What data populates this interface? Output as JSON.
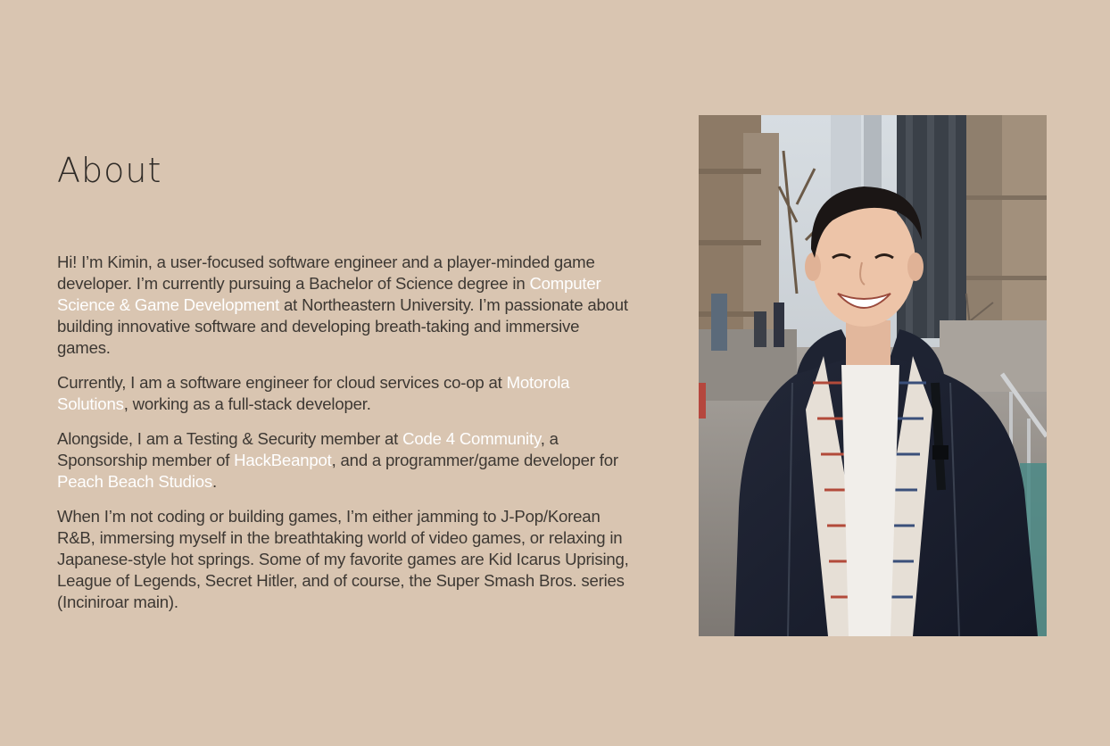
{
  "about": {
    "title": "About",
    "p1": {
      "t1": "Hi! I’m Kimin, a user-focused software engineer and a player-minded game developer. I’m currently pursuing a Bachelor of Science degree in ",
      "link1": "Computer Science & Game Development",
      "t2": " at Northeastern University. I’m passionate about building innovative software and developing breath-taking and immersive games."
    },
    "p2": {
      "t1": "Currently, I am a software engineer for cloud services co-op at ",
      "link1": "Motorola Solutions",
      "t2": ", working as a full-stack developer."
    },
    "p3": {
      "t1": "Alongside, I am a Testing & Security member at ",
      "link1": "Code 4 Community",
      "t2": ", a Sponsorship member of ",
      "link2": "HackBeanpot",
      "t3": ", and a programmer/game developer for ",
      "link3": "Peach Beach Studios",
      "t4": "."
    },
    "p4": {
      "t1": "When I’m not coding or building games, I’m either jamming to J-Pop/Korean R&B, immersing myself in the breathtaking world of video games, or relaxing in Japanese-style hot springs. Some of my favorite games are Kid Icarus Uprising, League of Legends, Secret Hitler, and of course, the Super Smash Bros. series (Inciniroar main)."
    }
  },
  "colors": {
    "background": "#d9c5b1",
    "text": "#3d3833",
    "link": "#ffffff"
  }
}
